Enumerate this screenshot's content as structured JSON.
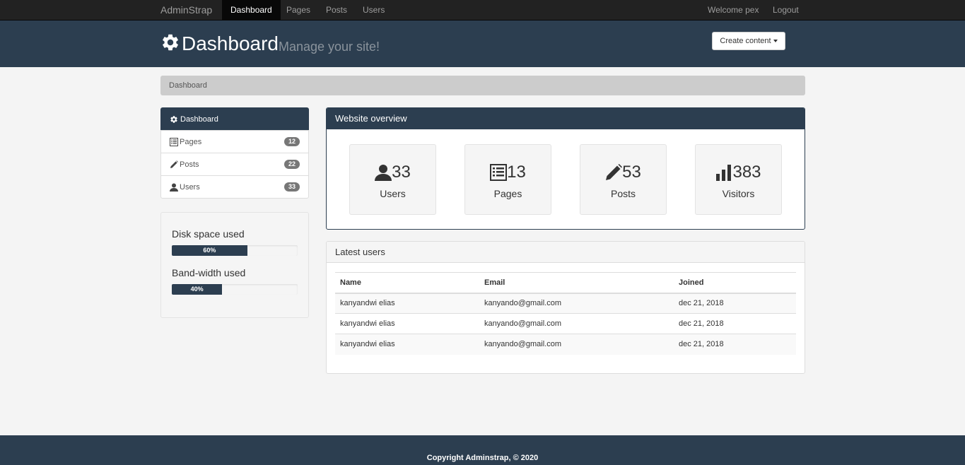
{
  "navbar": {
    "brand": "AdminStrap",
    "items": [
      {
        "label": "Dashboard",
        "active": true
      },
      {
        "label": "Pages"
      },
      {
        "label": "Posts"
      },
      {
        "label": "Users"
      }
    ],
    "welcome": "Welcome pex",
    "logout": "Logout"
  },
  "header": {
    "title": "Dashboard",
    "subtitle": "Manage your site!",
    "create_button": "Create content"
  },
  "breadcrumb": "Dashboard",
  "sidebar": {
    "items": [
      {
        "label": "Dashboard",
        "icon": "gear-icon",
        "active": true
      },
      {
        "label": "Pages",
        "icon": "list-icon",
        "badge": "12"
      },
      {
        "label": "Posts",
        "icon": "pencil-icon",
        "badge": "22"
      },
      {
        "label": "Users",
        "icon": "user-icon",
        "badge": "33"
      }
    ]
  },
  "usage": {
    "disk_label": "Disk space used",
    "disk_percent_text": "60%",
    "disk_value": 0.6,
    "bandwidth_label": "Band-width used",
    "bandwidth_percent_text": "40%",
    "bandwidth_value": 0.4
  },
  "overview": {
    "title": "Website overview",
    "stats": [
      {
        "value": "33",
        "label": "Users",
        "icon": "user-icon"
      },
      {
        "value": "13",
        "label": "Pages",
        "icon": "list-icon"
      },
      {
        "value": "53",
        "label": "Posts",
        "icon": "pencil-icon"
      },
      {
        "value": "383",
        "label": "Visitors",
        "icon": "stats-icon"
      }
    ]
  },
  "latest_users": {
    "title": "Latest users",
    "columns": [
      "Name",
      "Email",
      "Joined"
    ],
    "rows": [
      [
        "kanyandwi elias",
        "kanyando@gmail.com",
        "dec 21, 2018"
      ],
      [
        "kanyandwi elias",
        "kanyando@gmail.com",
        "dec 21, 2018"
      ],
      [
        "kanyandwi elias",
        "kanyando@gmail.com",
        "dec 21, 2018"
      ]
    ]
  },
  "footer": "Copyright Adminstrap, © 2020",
  "colors": {
    "primary": "#2c3e50",
    "navbar": "#222222"
  }
}
